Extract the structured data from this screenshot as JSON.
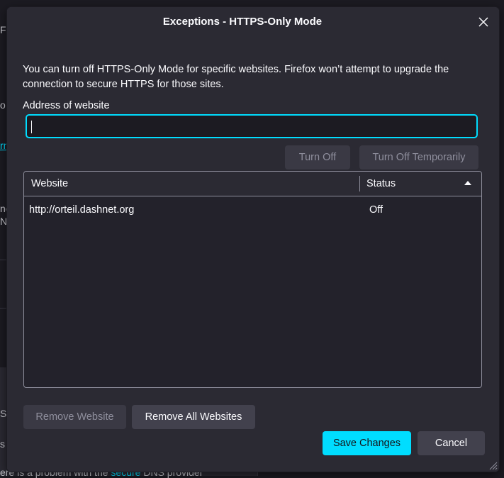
{
  "background": {
    "fragments": [
      "Fi",
      "o",
      "rn",
      "nc",
      "NS",
      "S",
      "s"
    ],
    "bottom_text_a": "ere is a problem with the",
    "bottom_text_link": "secure",
    "bottom_text_b": "DNS provider"
  },
  "dialog": {
    "title": "Exceptions - HTTPS-Only Mode",
    "close_icon": "close-icon",
    "description": "You can turn off HTTPS-Only Mode for specific websites. Firefox won’t attempt to upgrade the connection to secure HTTPS for those sites.",
    "address_label": "Address of website",
    "address_value": "",
    "address_placeholder": "",
    "buttons": {
      "turn_off": "Turn Off",
      "turn_off_temp": "Turn Off Temporarily",
      "remove_website": "Remove Website",
      "remove_all": "Remove All Websites",
      "save": "Save Changes",
      "cancel": "Cancel"
    },
    "table": {
      "col_website": "Website",
      "col_status": "Status",
      "sort_icon": "sort-ascending-icon",
      "rows": [
        {
          "website": "http://orteil.dashnet.org",
          "status": "Off"
        }
      ]
    }
  },
  "colors": {
    "accent": "#00ddff",
    "dialog_bg": "#2b2a33",
    "page_bg": "#1c1b22"
  }
}
